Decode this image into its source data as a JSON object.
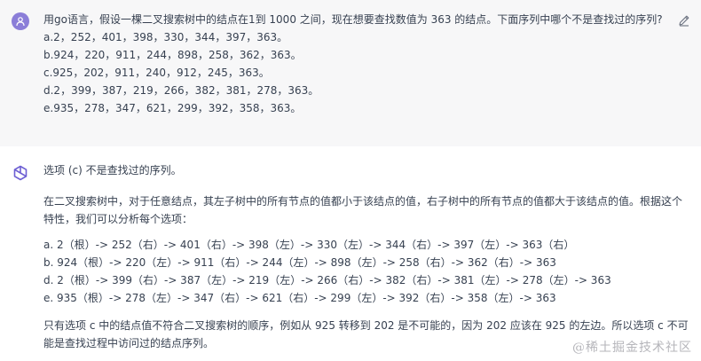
{
  "user_message": {
    "question": "用go语言，假设一棵二叉搜索树中的结点在1到 1000 之间，现在想要查找数值为 363 的结点。下面序列中哪个不是查找过的序列?",
    "options": [
      "a.2，252，401，398，330，344，397，363。",
      "b.924，220，911，244，898，258，362，363。",
      "c.925，202，911，240，912，245，363。",
      "d.2，399，387，219，266，382，381，278，363。",
      "e.935，278，347，621，299，392，358，363。"
    ],
    "edit_icon": "pencil-icon",
    "avatar_icon": "user-icon"
  },
  "assistant_message": {
    "avatar_icon": "openai-logo-icon",
    "answer": "选项 (c) 不是查找过的序列。",
    "explanation": "在二叉搜索树中，对于任意结点，其左子树中的所有节点的值都小于该结点的值，右子树中的所有节点的值都大于该结点的值。根据这个特性，我们可以分析每个选项：",
    "sequences": [
      "a. 2（根）-> 252（右）-> 401（右）-> 398（左）-> 330（左）-> 344（右）-> 397（左）-> 363（右）",
      "b. 924（根）-> 220（左）-> 911（右）-> 244（左）-> 898（左）-> 258（右）-> 362（右）-> 363",
      "d. 2（根）-> 399（右）-> 387（左）-> 219（左）-> 266（右）-> 382（右）-> 381（左）-> 278（左）-> 363",
      "e. 935（根）-> 278（左）-> 347（右）-> 621（右）-> 299（左）-> 392（右）-> 358（左）-> 363"
    ],
    "conclusion": "只有选项 c 中的结点值不符合二叉搜索树的顺序，例如从 925 转移到 202 是不可能的，因为 202 应该在 925 的左边。所以选项 c 不可能是查找过程中访问过的结点序列。"
  },
  "watermark": "@稀土掘金技术社区",
  "colors": {
    "user_bg": "#f7f7f8",
    "avatar_purple": "#8b7ed8",
    "text": "#374151"
  }
}
